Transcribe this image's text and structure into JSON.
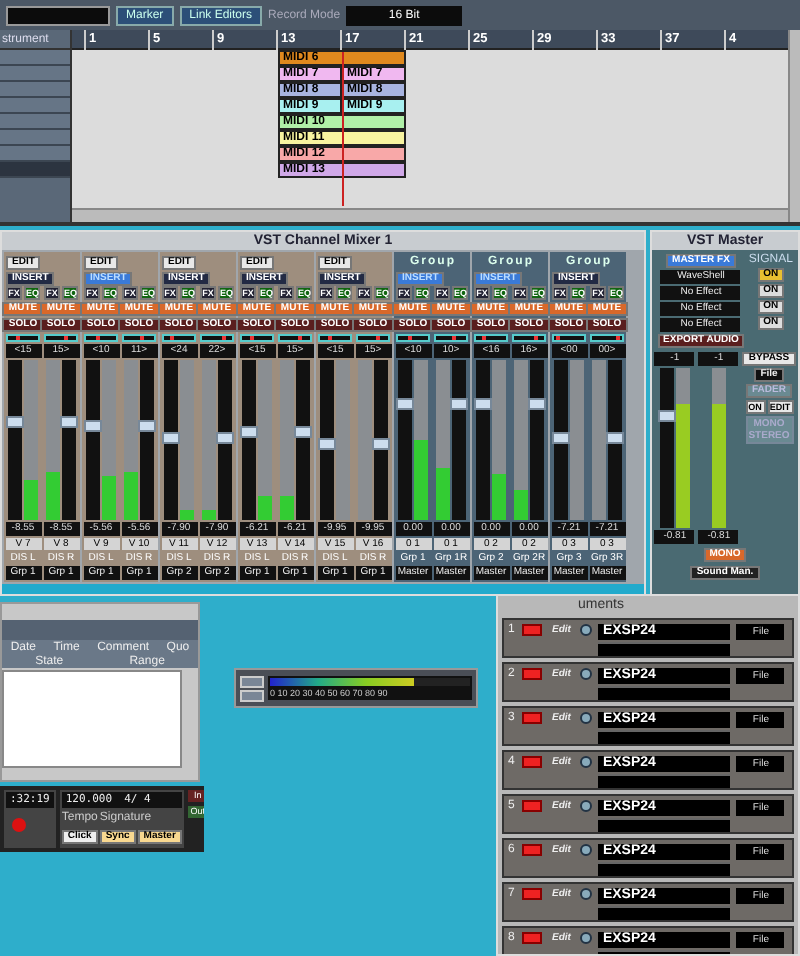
{
  "arrange": {
    "toolbar": {
      "marker": "Marker",
      "link_editors": "Link Editors",
      "record_mode_label": "Record Mode",
      "record_mode": "16 Bit"
    },
    "track_header": "strument",
    "tracks": [
      {
        "selected": false
      },
      {
        "selected": false
      },
      {
        "selected": false
      },
      {
        "selected": false
      },
      {
        "selected": false
      },
      {
        "selected": false
      },
      {
        "selected": false
      },
      {
        "selected": true
      }
    ],
    "ruler": [
      "1",
      "5",
      "9",
      "13",
      "17",
      "21",
      "25",
      "29",
      "33",
      "37",
      "4"
    ],
    "lanes": [
      {
        "parts": [
          {
            "name": "MIDI 6",
            "color": "#e0891e"
          }
        ]
      },
      {
        "parts": [
          {
            "name": "MIDI 7",
            "color": "#f0b8f0"
          },
          {
            "name": "MIDI 7",
            "color": "#f0b8f0"
          }
        ]
      },
      {
        "parts": [
          {
            "name": "MIDI 8",
            "color": "#a8b4e0"
          },
          {
            "name": "MIDI 8",
            "color": "#a8b4e0"
          }
        ]
      },
      {
        "parts": [
          {
            "name": "MIDI 9",
            "color": "#a8f0f0"
          },
          {
            "name": "MIDI 9",
            "color": "#a8f0f0"
          }
        ]
      },
      {
        "parts": [
          {
            "name": "MIDI 10",
            "color": "#b0f0a8"
          }
        ]
      },
      {
        "parts": [
          {
            "name": "MIDI 11",
            "color": "#f8f4a0"
          }
        ]
      },
      {
        "parts": [
          {
            "name": "MIDI 12",
            "color": "#f8a8a8"
          }
        ]
      },
      {
        "parts": [
          {
            "name": "MIDI 13",
            "color": "#d0a8e8"
          }
        ]
      }
    ]
  },
  "mixer": {
    "title": "VST Channel Mixer 1",
    "pairs": [
      {
        "kind": "channel",
        "header": "EDIT",
        "insert": "INSERT",
        "insert_on": false,
        "strips": [
          {
            "buttons": [
              "FX",
              "EQ",
              "MUTE",
              "SOLO"
            ],
            "pan": {
              "level": 0.3,
              "reading": "<15"
            },
            "fader": {
              "level": 0.62
            },
            "meter": {
              "level": 0.25
            },
            "volume": "-8.55",
            "name": "V 7",
            "route": "DIS L",
            "output": "Grp 1"
          },
          {
            "buttons": [
              "FX",
              "EQ",
              "MUTE",
              "SOLO"
            ],
            "pan": {
              "level": 0.7,
              "reading": "15>"
            },
            "fader": {
              "level": 0.62
            },
            "meter": {
              "level": 0.3
            },
            "volume": "-8.55",
            "name": "V 8",
            "route": "DIS R",
            "output": "Grp 1"
          }
        ]
      },
      {
        "kind": "channel",
        "header": "EDIT",
        "insert": "INSERT",
        "insert_on": true,
        "strips": [
          {
            "buttons": [
              "FX",
              "EQ",
              "MUTE",
              "SOLO"
            ],
            "pan": {
              "level": 0.35,
              "reading": "<10"
            },
            "fader": {
              "level": 0.6
            },
            "meter": {
              "level": 0.27
            },
            "volume": "-5.56",
            "name": "V 9",
            "route": "DIS L",
            "output": "Grp 1"
          },
          {
            "buttons": [
              "FX",
              "EQ",
              "MUTE",
              "SOLO"
            ],
            "pan": {
              "level": 0.65,
              "reading": "11>"
            },
            "fader": {
              "level": 0.6
            },
            "meter": {
              "level": 0.3
            },
            "volume": "-5.56",
            "name": "V 10",
            "route": "DIS R",
            "output": "Grp 1"
          }
        ]
      },
      {
        "kind": "channel",
        "header": "EDIT",
        "insert": "INSERT",
        "insert_on": false,
        "strips": [
          {
            "buttons": [
              "FX",
              "EQ",
              "MUTE",
              "SOLO"
            ],
            "pan": {
              "level": 0.2,
              "reading": "<24"
            },
            "fader": {
              "level": 0.52
            },
            "meter": {
              "level": 0.06
            },
            "volume": "-7.90",
            "name": "V 11",
            "route": "DIS L",
            "output": "Grp 2"
          },
          {
            "buttons": [
              "FX",
              "EQ",
              "MUTE",
              "SOLO"
            ],
            "pan": {
              "level": 0.8,
              "reading": "22>"
            },
            "fader": {
              "level": 0.52
            },
            "meter": {
              "level": 0.06
            },
            "volume": "-7.90",
            "name": "V 12",
            "route": "DIS R",
            "output": "Grp 2"
          }
        ]
      },
      {
        "kind": "channel",
        "header": "EDIT",
        "insert": "INSERT",
        "insert_on": false,
        "strips": [
          {
            "buttons": [
              "FX",
              "EQ",
              "MUTE",
              "SOLO"
            ],
            "pan": {
              "level": 0.3,
              "reading": "<15"
            },
            "fader": {
              "level": 0.56
            },
            "meter": {
              "level": 0.15
            },
            "volume": "-6.21",
            "name": "V 13",
            "route": "DIS L",
            "output": "Grp 1"
          },
          {
            "buttons": [
              "FX",
              "EQ",
              "MUTE",
              "SOLO"
            ],
            "pan": {
              "level": 0.7,
              "reading": "15>"
            },
            "fader": {
              "level": 0.56
            },
            "meter": {
              "level": 0.15
            },
            "volume": "-6.21",
            "name": "V 14",
            "route": "DIS R",
            "output": "Grp 1"
          }
        ]
      },
      {
        "kind": "channel",
        "header": "EDIT",
        "insert": "INSERT",
        "insert_on": false,
        "strips": [
          {
            "buttons": [
              "FX",
              "EQ",
              "MUTE",
              "SOLO"
            ],
            "pan": {
              "level": 0.3,
              "reading": "<15"
            },
            "fader": {
              "level": 0.47
            },
            "volume": "-9.95",
            "name": "V 15",
            "route": "DIS L",
            "output": "Grp 1"
          },
          {
            "buttons": [
              "FX",
              "EQ",
              "MUTE",
              "SOLO"
            ],
            "pan": {
              "level": 0.7,
              "reading": "15>"
            },
            "fader": {
              "level": 0.47
            },
            "volume": "-9.95",
            "name": "V 16",
            "route": "DIS R",
            "output": "Grp 1"
          }
        ]
      },
      {
        "kind": "group",
        "header": "Group",
        "insert": "INSERT",
        "insert_on": true,
        "strips": [
          {
            "buttons": [
              "FX",
              "EQ",
              "MUTE",
              "SOLO"
            ],
            "pan": {
              "level": 0.35,
              "reading": "<10"
            },
            "fader": {
              "level": 0.74
            },
            "meter": {
              "level": 0.5
            },
            "volume": "0.00",
            "name": "0 1",
            "route": "Grp 1",
            "output": "Master"
          },
          {
            "buttons": [
              "FX",
              "EQ",
              "MUTE",
              "SOLO"
            ],
            "pan": {
              "level": 0.65,
              "reading": "10>"
            },
            "fader": {
              "level": 0.74
            },
            "meter": {
              "level": 0.33
            },
            "volume": "0.00",
            "name": "0 1",
            "route": "Grp 1R",
            "output": "Master"
          }
        ]
      },
      {
        "kind": "group",
        "header": "Group",
        "insert": "INSERT",
        "insert_on": true,
        "strips": [
          {
            "buttons": [
              "FX",
              "EQ",
              "MUTE",
              "SOLO"
            ],
            "pan": {
              "level": 0.25,
              "reading": "<16"
            },
            "fader": {
              "level": 0.74
            },
            "meter": {
              "level": 0.29
            },
            "volume": "0.00",
            "name": "0 2",
            "route": "Grp 2",
            "output": "Master"
          },
          {
            "buttons": [
              "FX",
              "EQ",
              "MUTE",
              "SOLO"
            ],
            "pan": {
              "level": 0.75,
              "reading": "16>"
            },
            "fader": {
              "level": 0.74
            },
            "meter": {
              "level": 0.19
            },
            "volume": "0.00",
            "name": "0 2",
            "route": "Grp 2R",
            "output": "Master"
          }
        ]
      },
      {
        "kind": "group",
        "header": "Group",
        "insert": "INSERT",
        "insert_on": false,
        "strips": [
          {
            "buttons": [
              "FX",
              "EQ",
              "MUTE",
              "SOLO"
            ],
            "pan": {
              "level": 0.05,
              "reading": "<00"
            },
            "fader": {
              "level": 0.52
            },
            "volume": "-7.21",
            "name": "0 3",
            "route": "Grp 3",
            "output": "Master"
          },
          {
            "buttons": [
              "FX",
              "EQ",
              "MUTE",
              "SOLO"
            ],
            "pan": {
              "level": 0.95,
              "reading": "00>"
            },
            "fader": {
              "level": 0.52
            },
            "volume": "-7.21",
            "name": "0 3",
            "route": "Grp 3R",
            "output": "Master"
          }
        ]
      }
    ]
  },
  "master": {
    "title": "VST Master",
    "fx_button": "MASTER FX",
    "slots": [
      "WaveShell",
      "No Effect",
      "No Effect",
      "No Effect"
    ],
    "export": "EXPORT AUDIO",
    "signal_label": "SIGNAL",
    "signal": [
      {
        "label": "ON",
        "on": true
      },
      {
        "label": "ON",
        "on": false
      },
      {
        "label": "ON",
        "on": false
      },
      {
        "label": "ON",
        "on": false
      }
    ],
    "peaks": [
      "-1",
      "-1"
    ],
    "fader": {
      "level": 0.72
    },
    "meters": [
      {
        "level": 0.78
      },
      {
        "level": 0.78
      }
    ],
    "bypass": "BYPASS",
    "file": "File",
    "fader_label": "FADER",
    "on": "ON",
    "edit": "EDIT",
    "mono_stereo": "MONO STEREO",
    "volumes": [
      "-0.81",
      "-0.81"
    ],
    "mono": "MONO",
    "sound_man": "Sound Man."
  },
  "pool": {
    "headers": [
      "Date",
      "Time",
      "Comment",
      "Quo"
    ],
    "subheaders": [
      "State",
      "Range"
    ]
  },
  "transport": {
    "time": ":32:19",
    "tempo": "120.000",
    "signature": "4/ 4",
    "tempo_label": "Tempo",
    "signature_label": "Signature",
    "buttons": [
      "Click",
      "Sync",
      "Master"
    ],
    "in": "In",
    "out": "Out"
  },
  "performance": {
    "scale": "0 10 20 30 40 50 60 70 80 90",
    "level": 0.72
  },
  "instruments": {
    "title": "uments",
    "rows": [
      {
        "number": "1",
        "edit": "Edit",
        "name": "EXSP24",
        "file": "File"
      },
      {
        "number": "2",
        "edit": "Edit",
        "name": "EXSP24",
        "file": "File"
      },
      {
        "number": "3",
        "edit": "Edit",
        "name": "EXSP24",
        "file": "File"
      },
      {
        "number": "4",
        "edit": "Edit",
        "name": "EXSP24",
        "file": "File"
      },
      {
        "number": "5",
        "edit": "Edit",
        "name": "EXSP24",
        "file": "File"
      },
      {
        "number": "6",
        "edit": "Edit",
        "name": "EXSP24",
        "file": "File"
      },
      {
        "number": "7",
        "edit": "Edit",
        "name": "EXSP24",
        "file": "File"
      },
      {
        "number": "8",
        "edit": "Edit",
        "name": "EXSP24",
        "file": "File"
      }
    ]
  }
}
